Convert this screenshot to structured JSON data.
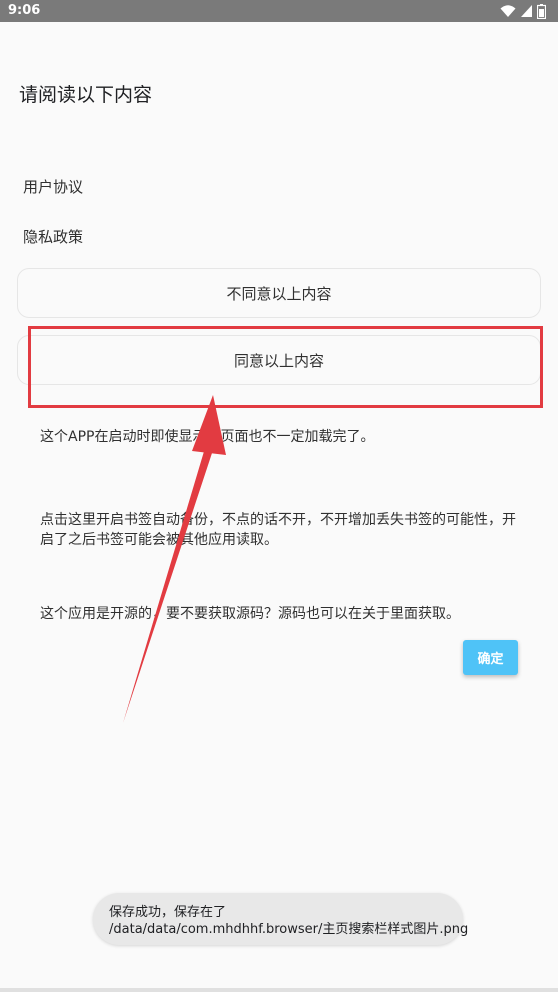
{
  "status_bar": {
    "time": "9:06",
    "icons": [
      "wifi-icon",
      "signal-icon",
      "battery-icon"
    ]
  },
  "page": {
    "title": "请阅读以下内容"
  },
  "links": {
    "user_agreement": "用户协议",
    "privacy_policy": "隐私政策"
  },
  "options": {
    "disagree": "不同意以上内容",
    "agree": "同意以上内容"
  },
  "info": {
    "line1": "这个APP在启动时即使显示了页面也不一定加载完了。",
    "line2": "点击这里开启书签自动备份，不点的话不开，不开增加丢失书签的可能性，开启了之后书签可能会被其他应用读取。",
    "line3": "这个应用是开源的，要不要获取源码？源码也可以在关于里面获取。"
  },
  "confirm_button": "确定",
  "toast": {
    "line1": "保存成功，保存在了",
    "line2": "/data/data/com.mhdhhf.browser/主页搜索栏样式图片.png"
  },
  "colors": {
    "highlight": "#e23b41",
    "accent": "#4fc3f7",
    "status_bar": "#7a7a7a"
  }
}
